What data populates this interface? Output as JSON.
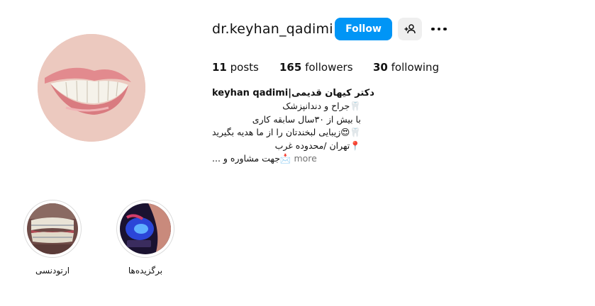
{
  "profile": {
    "username": "dr.keyhan_qadimi",
    "follow_label": "Follow",
    "stats": {
      "posts_count": "11",
      "posts_label": "posts",
      "followers_count": "165",
      "followers_label": "followers",
      "following_count": "30",
      "following_label": "following"
    },
    "full_name": "keyhan qadimi|دکتر کیهان قدیمی",
    "bio_lines": [
      "🦷جراح و دندانپزشک",
      "با بیش از ۳۰سال سابقه کاری",
      "🦷😍زیبایی لبخندتان را از ما هدیه بگیرید",
      "📍تهران /محدوده غرب",
      "📩جهت مشاوره و ..."
    ],
    "more_label": "more"
  },
  "highlights": [
    {
      "label": "ارتودنسی"
    },
    {
      "label": "برگزیده‌ها"
    }
  ],
  "icons": {
    "add_user": "add-user-icon",
    "more": "more-options-icon"
  },
  "colors": {
    "accent": "#0095f6",
    "secondary_button": "#efefef",
    "muted_text": "#737373"
  }
}
